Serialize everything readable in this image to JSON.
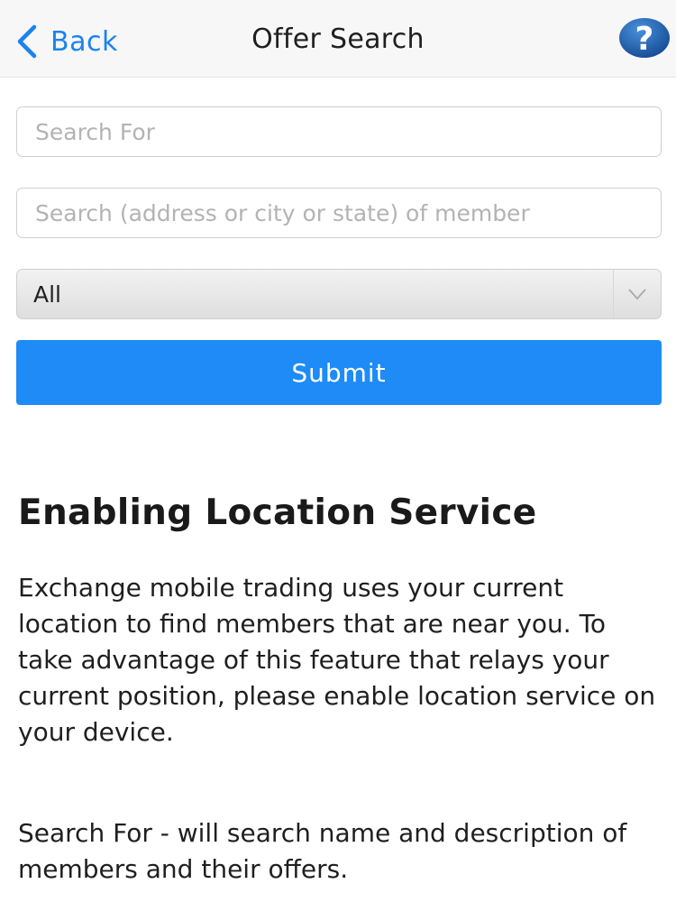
{
  "nav": {
    "back_label": "Back",
    "title": "Offer Search",
    "help_label": "?"
  },
  "form": {
    "search_for_placeholder": "Search For",
    "location_placeholder": "Search (address or city or state) of member",
    "category_selected": "All",
    "submit_label": "Submit"
  },
  "info": {
    "title": "Enabling Location Service",
    "paragraph_1": "Exchange mobile trading uses your current location to find members that are near you. To take  advantage of this feature that relays your current position, please enable location service on your device.",
    "paragraph_2": "Search For - will search name and description of members and their offers."
  },
  "colors": {
    "accent": "#1e8bf6",
    "help_badge": "#1d5fae"
  },
  "icons": {
    "back": "chevron-left-icon",
    "help": "question-mark-icon",
    "dropdown": "chevron-down-icon"
  }
}
